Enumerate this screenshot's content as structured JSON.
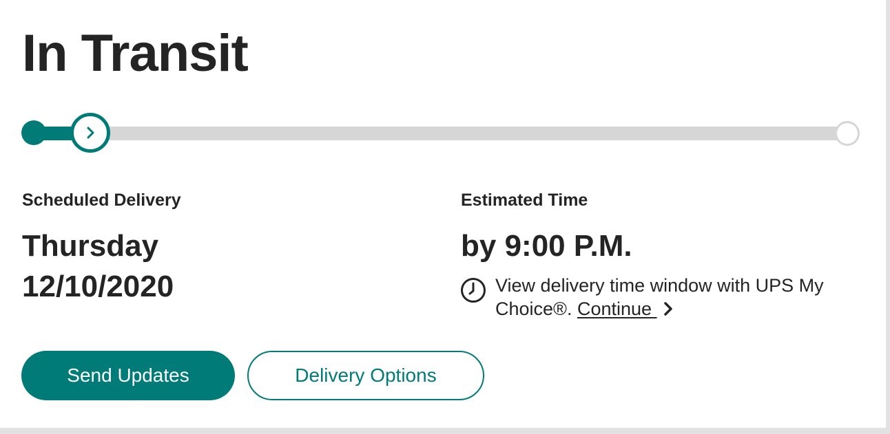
{
  "status": {
    "title": "In Transit"
  },
  "progress": {
    "current_step": 2,
    "fraction": 0.07,
    "accent_color": "#007b78",
    "track_color": "#d6d6d6"
  },
  "delivery": {
    "scheduled_label": "Scheduled Delivery",
    "day": "Thursday",
    "date": "12/10/2020",
    "estimated_label": "Estimated Time",
    "time": "by 9:00 P.M."
  },
  "mychoice_note": {
    "text": "View delivery time window with UPS My Choice®. ",
    "link_label": "Continue ",
    "icon": "clock-icon",
    "link_icon": "chevron-right-icon"
  },
  "actions": {
    "send_updates_label": "Send Updates",
    "delivery_options_label": "Delivery Options"
  }
}
